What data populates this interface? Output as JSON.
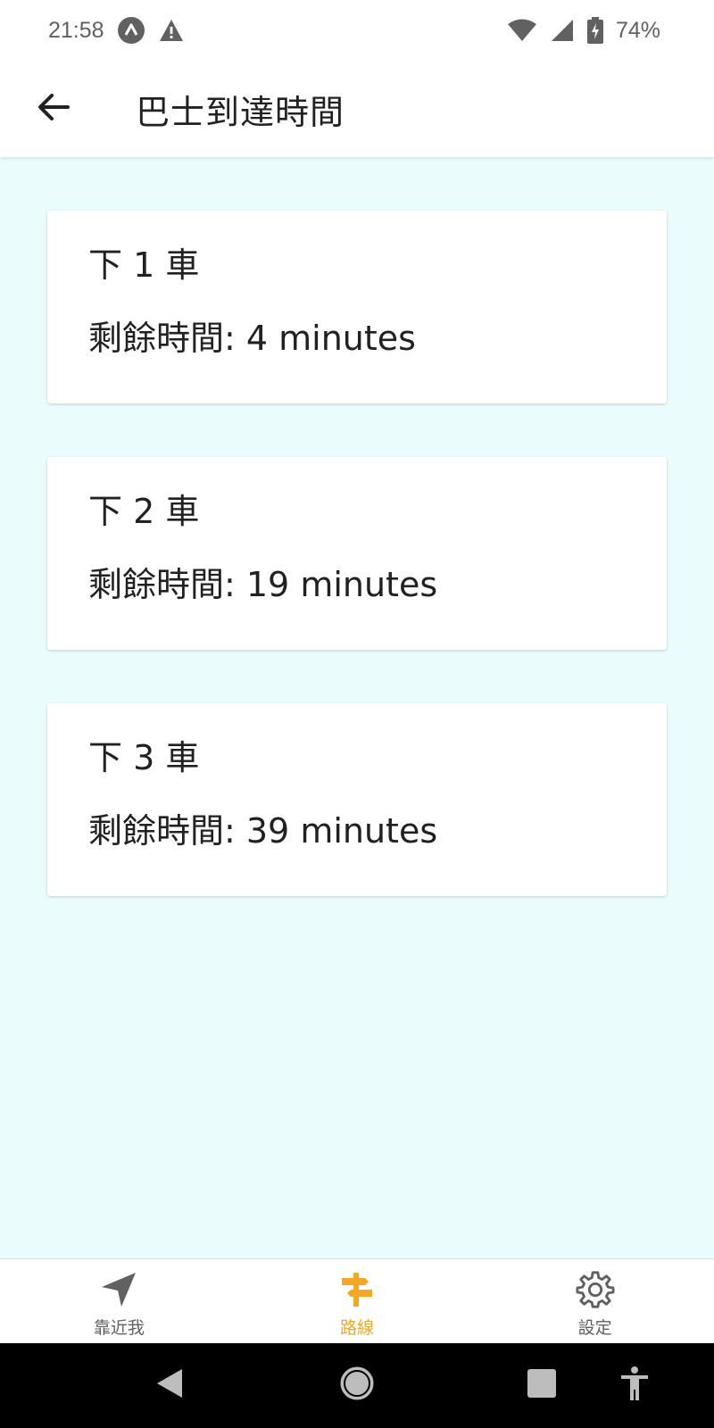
{
  "status_bar": {
    "time": "21:58",
    "battery": "74%",
    "icons": [
      "app-notification-icon",
      "warning-icon",
      "wifi-icon",
      "cell-signal-icon",
      "battery-charging-icon"
    ]
  },
  "app_bar": {
    "title": "巴士到達時間",
    "back_icon": "arrow-back-icon"
  },
  "cards": [
    {
      "title": "下 1 車",
      "remaining": "剩餘時間: 4 minutes"
    },
    {
      "title": "下 2 車",
      "remaining": "剩餘時間: 19 minutes"
    },
    {
      "title": "下 3 車",
      "remaining": "剩餘時間: 39 minutes"
    }
  ],
  "bottom_nav": {
    "items": [
      {
        "label": "靠近我",
        "icon": "navigation-arrow-icon",
        "active": false
      },
      {
        "label": "路線",
        "icon": "signpost-icon",
        "active": true
      },
      {
        "label": "設定",
        "icon": "gear-icon",
        "active": false
      }
    ]
  },
  "colors": {
    "background": "#ebfcfd",
    "active": "#f5a623",
    "inactive": "#616161",
    "text": "#212121"
  },
  "system_nav": {
    "buttons": [
      "back-triangle-icon",
      "home-circle-icon",
      "recents-square-icon",
      "accessibility-icon"
    ]
  }
}
